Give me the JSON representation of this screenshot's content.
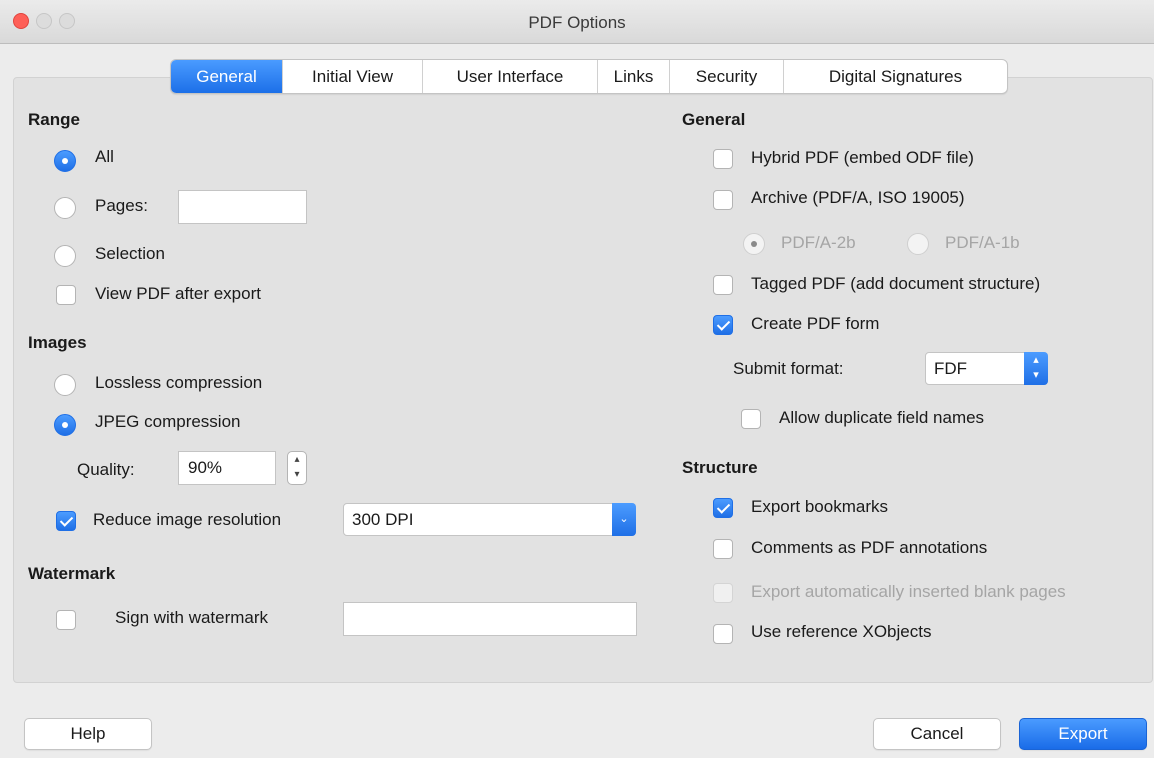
{
  "window": {
    "title": "PDF Options"
  },
  "tabs": [
    "General",
    "Initial View",
    "User Interface",
    "Links",
    "Security",
    "Digital Signatures"
  ],
  "active_tab": "General",
  "range": {
    "heading": "Range",
    "all_label": "All",
    "pages_label": "Pages:",
    "pages_value": "",
    "selection_label": "Selection",
    "view_after_label": "View PDF after export",
    "selected": "All",
    "view_after_checked": false
  },
  "images": {
    "heading": "Images",
    "lossless_label": "Lossless compression",
    "jpeg_label": "JPEG compression",
    "selected": "JPEG compression",
    "quality_label": "Quality:",
    "quality_value": "90%",
    "reduce_label": "Reduce image resolution",
    "reduce_checked": true,
    "resolution_value": "300 DPI"
  },
  "watermark": {
    "heading": "Watermark",
    "sign_label": "Sign with watermark",
    "sign_checked": false,
    "text_value": ""
  },
  "general": {
    "heading": "General",
    "hybrid_label": "Hybrid PDF (embed ODF file)",
    "hybrid_checked": false,
    "archive_label": "Archive (PDF/A, ISO 19005)",
    "archive_checked": false,
    "pdfa2b_label": "PDF/A-2b",
    "pdfa1b_label": "PDF/A-1b",
    "pdfa_selected": "PDF/A-2b",
    "tagged_label": "Tagged PDF (add document structure)",
    "tagged_checked": false,
    "form_label": "Create PDF form",
    "form_checked": true,
    "submit_label": "Submit format:",
    "submit_value": "FDF",
    "duplicate_label": "Allow duplicate field names",
    "duplicate_checked": false
  },
  "structure": {
    "heading": "Structure",
    "bookmarks_label": "Export bookmarks",
    "bookmarks_checked": true,
    "comments_label": "Comments as PDF annotations",
    "comments_checked": false,
    "blank_label": "Export automatically inserted blank pages",
    "blank_checked": false,
    "blank_enabled": false,
    "xobjects_label": "Use reference XObjects",
    "xobjects_checked": false
  },
  "buttons": {
    "help": "Help",
    "cancel": "Cancel",
    "export": "Export"
  },
  "colors": {
    "accent": "#1f6fe6",
    "close": "#fe5f57"
  }
}
